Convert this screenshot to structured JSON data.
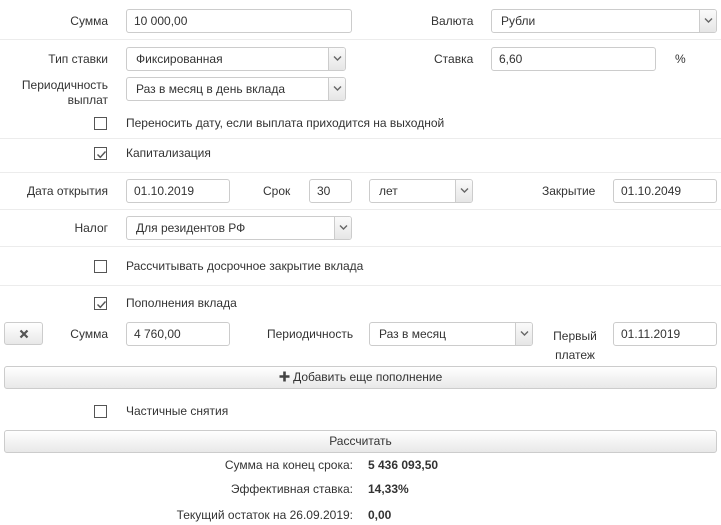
{
  "form": {
    "amount": {
      "label": "Сумма",
      "value": "10 000,00"
    },
    "currency": {
      "label": "Валюта",
      "selected": "Рубли"
    },
    "rate_type": {
      "label": "Тип ставки",
      "selected": "Фиксированная"
    },
    "rate": {
      "label": "Ставка",
      "value": "6,60",
      "unit": "%"
    },
    "periodicity": {
      "label_line1": "Периодичность",
      "label_line2": "выплат",
      "selected": "Раз в месяц в день вклада"
    },
    "move_date": {
      "label": "Переносить дату, если выплата приходится на выходной",
      "checked": false
    },
    "capitalization": {
      "label": "Капитализация",
      "checked": true
    },
    "open_date": {
      "label": "Дата открытия",
      "value": "01.10.2019"
    },
    "term": {
      "label": "Срок",
      "value": "30",
      "unit_selected": "лет"
    },
    "close_date": {
      "label": "Закрытие",
      "value": "01.10.2049"
    },
    "tax": {
      "label": "Налог",
      "selected": "Для резидентов РФ"
    },
    "early_close": {
      "label": "Рассчитывать досрочное закрытие вклада",
      "checked": false
    },
    "deposits": {
      "label": "Пополнения вклада",
      "checked": true
    },
    "deposit_row": {
      "amount_label": "Сумма",
      "amount_value": "4 760,00",
      "period_label": "Периодичность",
      "period_selected": "Раз в месяц",
      "first_label_line1": "Первый",
      "first_label_line2": "платеж",
      "first_value": "01.11.2019"
    },
    "add_deposit_label": "Добавить еще пополнение",
    "partial_withdrawals": {
      "label": "Частичные снятия",
      "checked": false
    },
    "calculate_label": "Рассчитать"
  },
  "results": [
    {
      "label": "Сумма на конец срока:",
      "value": "5 436 093,50"
    },
    {
      "label": "Эффективная ставка:",
      "value": "14,33%"
    },
    {
      "label": "Текущий остаток на 26.09.2019:",
      "value": "0,00"
    }
  ],
  "icons": {
    "select_arrow": "chevron-down-icon",
    "checked": "checkmark-icon",
    "remove": "close-icon",
    "add": "plus-icon"
  }
}
